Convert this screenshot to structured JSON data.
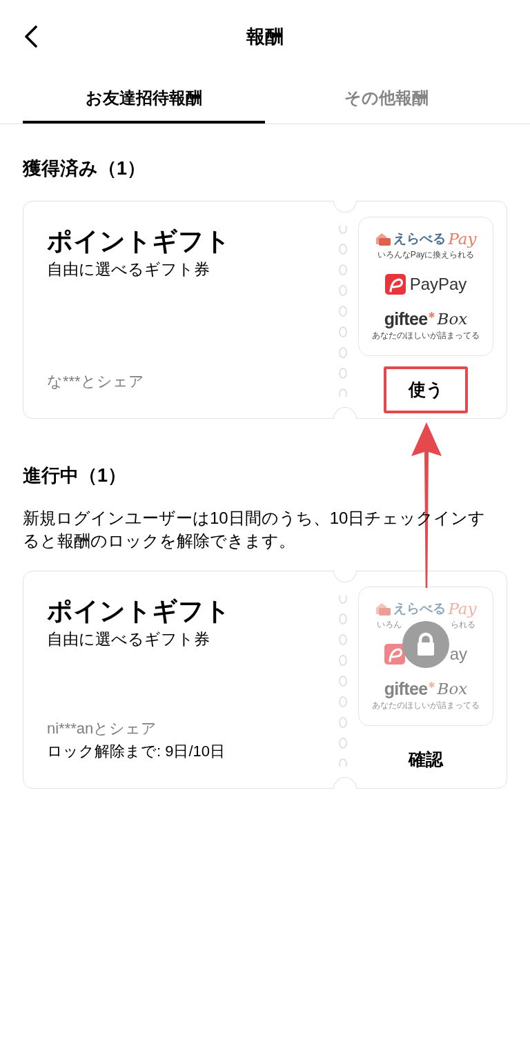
{
  "header": {
    "title": "報酬"
  },
  "tabs": [
    {
      "label": "お友達招待報酬",
      "selected": true
    },
    {
      "label": "その他報酬",
      "selected": false
    }
  ],
  "sections": [
    {
      "heading": "獲得済み（1）",
      "rewards": [
        {
          "title": "ポイントギフト",
          "subtitle": "自由に選べるギフト券",
          "shared_with": "な***とシェア",
          "locked": false,
          "brands": [
            {
              "kind": "erabel_pay",
              "name": "えらべる",
              "suffix": "Pay",
              "tagline": "いろんなPayに換えられる"
            },
            {
              "kind": "paypay",
              "name": "PayPay"
            },
            {
              "kind": "giftee_box",
              "name": "giftee",
              "suffix": "Box",
              "tagline": "あなたのほしいが詰まってる"
            }
          ],
          "action": {
            "label": "使う",
            "highlighted": true
          }
        }
      ]
    },
    {
      "heading": "進行中（1）",
      "description": "新規ログインユーザーは10日間のうち、10日チェックインすると報酬のロックを解除できます。",
      "rewards": [
        {
          "title": "ポイントギフト",
          "subtitle": "自由に選べるギフト券",
          "shared_with": "ni***anとシェア",
          "progress": "ロック解除まで: 9日/10日",
          "locked": true,
          "brands": [
            {
              "kind": "erabel_pay",
              "name": "えらべる",
              "suffix": "Pay",
              "tagline_parts": [
                "いろん",
                "られる"
              ]
            },
            {
              "kind": "paypay",
              "name_parts": [
                "ay"
              ]
            },
            {
              "kind": "giftee_box",
              "name": "giftee",
              "suffix": "Box",
              "tagline": "あなたのほしいが詰まってる"
            }
          ],
          "action": {
            "label": "確認",
            "highlighted": false
          }
        }
      ]
    }
  ]
}
